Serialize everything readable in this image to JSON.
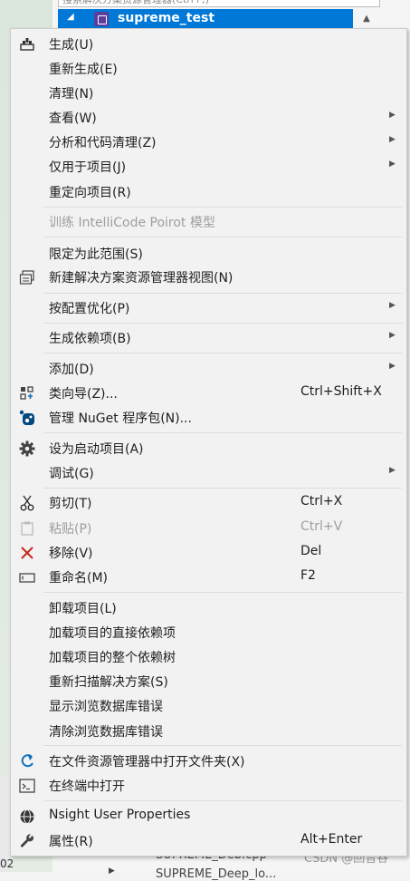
{
  "background": {
    "search_placeholder": "搜索解决方案资源管理器(Ctrl+;)",
    "selected_project": "supreme_test",
    "bottom_item_1": "SUPREME_Deb.cpp",
    "bottom_item_2": "SUPREME_Deep_lo...",
    "left_number": "02",
    "watermark": "CSDN @回音谷"
  },
  "menu": {
    "build": "生成(U)",
    "rebuild": "重新生成(E)",
    "clean": "清理(N)",
    "view": "查看(W)",
    "analyze": "分析和代码清理(Z)",
    "project_only": "仅用于项目(J)",
    "retarget": "重定向项目(R)",
    "intellicode": "训练 IntelliCode Poirot 模型",
    "scope": "限定为此范围(S)",
    "new_view": "新建解决方案资源管理器视图(N)",
    "pgo": "按配置优化(P)",
    "build_deps": "生成依赖项(B)",
    "add": "添加(D)",
    "class_wizard": "类向导(Z)...",
    "class_wizard_sc": "Ctrl+Shift+X",
    "nuget": "管理 NuGet 程序包(N)...",
    "startup": "设为启动项目(A)",
    "debug": "调试(G)",
    "cut": "剪切(T)",
    "cut_sc": "Ctrl+X",
    "paste": "粘贴(P)",
    "paste_sc": "Ctrl+V",
    "remove": "移除(V)",
    "remove_sc": "Del",
    "rename": "重命名(M)",
    "rename_sc": "F2",
    "unload": "卸载项目(L)",
    "load_direct": "加载项目的直接依赖项",
    "load_tree": "加载项目的整个依赖树",
    "rescan": "重新扫描解决方案(S)",
    "show_db_errors": "显示浏览数据库错误",
    "clear_db_errors": "清除浏览数据库错误",
    "open_folder": "在文件资源管理器中打开文件夹(X)",
    "open_terminal": "在终端中打开",
    "nsight": "Nsight User Properties",
    "properties": "属性(R)",
    "properties_sc": "Alt+Enter"
  },
  "colors": {
    "selection": "#0078d7",
    "remove_icon": "#c42b1c",
    "nuget_icon": "#004880"
  }
}
